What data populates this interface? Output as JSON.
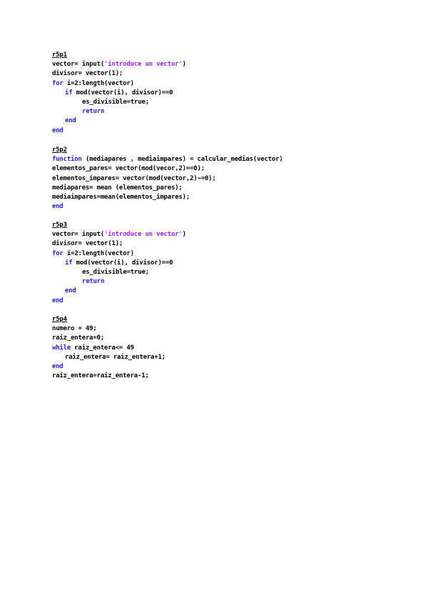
{
  "colors": {
    "keyword": "#1f1fd6",
    "string": "#a020f0",
    "text": "#000000"
  },
  "sections": [
    {
      "heading": "r5p1",
      "lines": [
        [
          {
            "t": "vector= input(",
            "c": "txt"
          },
          {
            "t": "'introduce un vector'",
            "c": "str"
          },
          {
            "t": ")",
            "c": "txt"
          }
        ],
        [
          {
            "t": "divisor= vector(1);",
            "c": "txt"
          }
        ],
        [
          {
            "t": "for ",
            "c": "kw"
          },
          {
            "t": "i=2:length(vector)",
            "c": "txt"
          }
        ],
        [
          {
            "t": "if ",
            "c": "kw"
          },
          {
            "t": "mod(vector(i), divisor)==0",
            "c": "txt"
          }
        ],
        [
          {
            "t": "es_divisible=true;",
            "c": "txt"
          }
        ],
        [
          {
            "t": "return",
            "c": "kw"
          }
        ],
        [
          {
            "t": "end",
            "c": "kw"
          }
        ],
        [
          {
            "t": "end",
            "c": "kw"
          }
        ]
      ]
    },
    {
      "heading": "r5p2",
      "lines": [
        [
          {
            "t": "function ",
            "c": "kw"
          },
          {
            "t": "(mediapares , mediaimpares) = calcular_medias(vector)",
            "c": "txt"
          }
        ],
        [
          {
            "t": "elementos_pares= vector(mod(vecor,2)==0);",
            "c": "txt"
          }
        ],
        [
          {
            "t": "elementos_impares= vector(mod(vector,2)~=0);",
            "c": "txt"
          }
        ],
        [
          {
            "t": "mediapares= mean (elementos_pares);",
            "c": "txt"
          }
        ],
        [
          {
            "t": "mediaimpares=mean(elementos_impares);",
            "c": "txt"
          }
        ],
        [
          {
            "t": "end",
            "c": "kw"
          }
        ]
      ]
    },
    {
      "heading": "r5p3",
      "lines": [
        [
          {
            "t": "vector= input(",
            "c": "txt"
          },
          {
            "t": "'introduce un vector'",
            "c": "str"
          },
          {
            "t": ")",
            "c": "txt"
          }
        ],
        [
          {
            "t": "divisor= vector(1);",
            "c": "txt"
          }
        ],
        [
          {
            "t": "for ",
            "c": "kw"
          },
          {
            "t": "i=2:length(vector)",
            "c": "txt"
          }
        ],
        [
          {
            "t": "if ",
            "c": "kw"
          },
          {
            "t": "mod(vector(i), divisor)==0",
            "c": "txt"
          }
        ],
        [
          {
            "t": "es_divisible=true;",
            "c": "txt"
          }
        ],
        [
          {
            "t": "return",
            "c": "kw"
          }
        ],
        [
          {
            "t": "end",
            "c": "kw"
          }
        ],
        [
          {
            "t": "end",
            "c": "kw"
          }
        ]
      ]
    },
    {
      "heading": "r5p4",
      "lines": [
        [
          {
            "t": "numero = 49;",
            "c": "txt"
          }
        ],
        [
          {
            "t": "raiz_entera=0;",
            "c": "txt"
          }
        ],
        [
          {
            "t": "while ",
            "c": "kw"
          },
          {
            "t": "raiz_entera<= 49",
            "c": "txt"
          }
        ],
        [
          {
            "t": "raiz_entera= raiz_entera+1;",
            "c": "txt"
          }
        ],
        [
          {
            "t": "end",
            "c": "kw"
          }
        ],
        [
          {
            "t": "raiz_entera=raiz_entera-1;",
            "c": "txt"
          }
        ]
      ]
    }
  ]
}
